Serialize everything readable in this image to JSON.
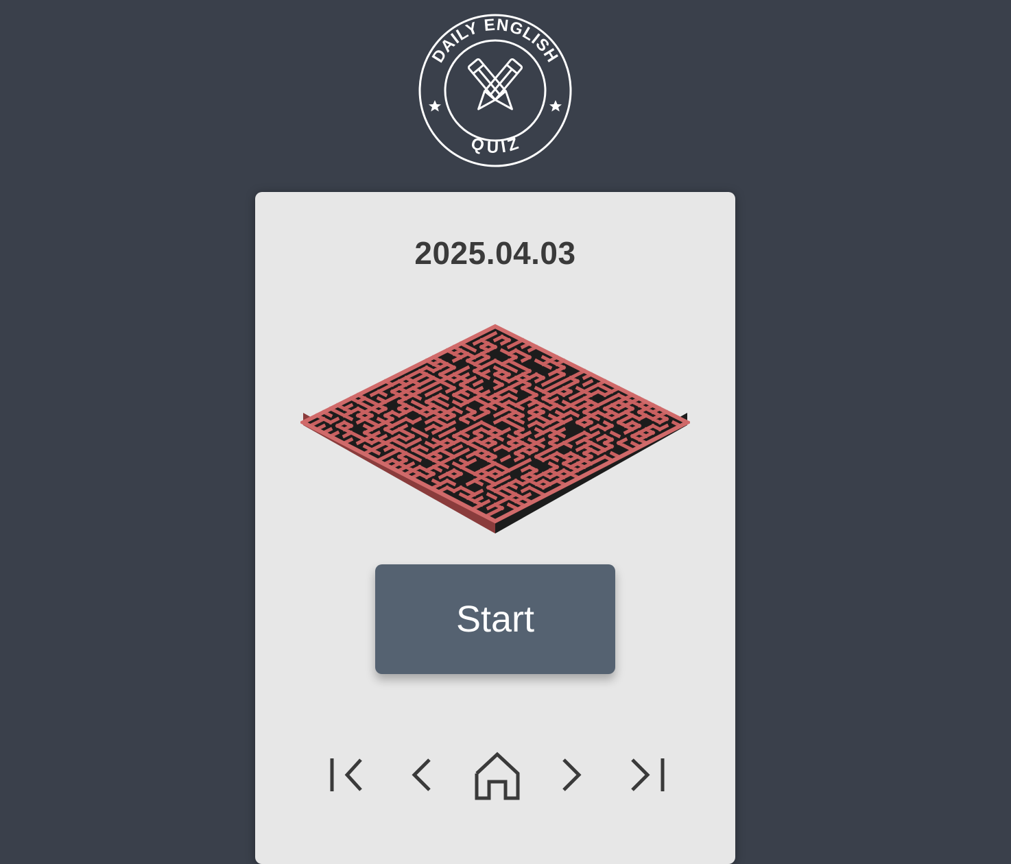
{
  "logo": {
    "top_text": "DAILY ENGLISH",
    "bottom_text": "QUIZ",
    "icon": "crossed-pencils-icon"
  },
  "card": {
    "date": "2025.04.03",
    "image": "isometric-maze",
    "start_label": "Start"
  },
  "nav": {
    "items": [
      "first-page-icon",
      "previous-page-icon",
      "home-icon",
      "next-page-icon",
      "last-page-icon"
    ]
  },
  "colors": {
    "background": "#3a404b",
    "card": "#e7e7e7",
    "button": "#556271",
    "maze_wall": "#c45c5c",
    "text": "#3a3a3a"
  }
}
